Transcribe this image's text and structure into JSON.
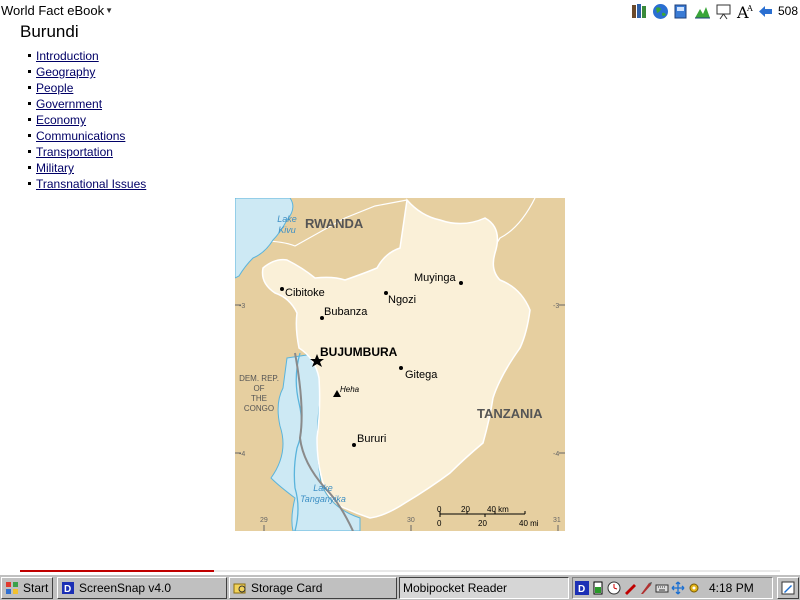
{
  "app": {
    "title": "World Fact eBook",
    "page_number": "508"
  },
  "toolbar": {
    "icons": [
      "library-icon",
      "globe-icon",
      "book-icon",
      "chart-icon",
      "presentation-icon",
      "font-size-icon",
      "back-arrow-icon"
    ]
  },
  "content": {
    "title": "Burundi",
    "nav": [
      {
        "label": "Introduction"
      },
      {
        "label": "Geography"
      },
      {
        "label": "People"
      },
      {
        "label": "Government"
      },
      {
        "label": "Economy"
      },
      {
        "label": "Communications"
      },
      {
        "label": "Transportation"
      },
      {
        "label": "Military"
      },
      {
        "label": "Transnational Issues"
      }
    ]
  },
  "map": {
    "countries": {
      "north": "RWANDA",
      "east": "TANZANIA",
      "west_lines": [
        "DEM. REP.",
        "OF",
        "THE",
        "CONGO"
      ]
    },
    "lakes": {
      "kivu_lines": [
        "Lake",
        "Kivu"
      ],
      "tanganyika_lines": [
        "Lake",
        "Tanganyika"
      ]
    },
    "capital": "BUJUMBURA",
    "cities": [
      "Muyinga",
      "Cibitoke",
      "Ngozi",
      "Bubanza",
      "Gitega",
      "Bururi"
    ],
    "peak": "Heha",
    "grid_labels": {
      "lat": [
        "-3",
        "-4"
      ],
      "lon": [
        "29",
        "30",
        "31"
      ]
    },
    "scale": {
      "km_labels": [
        "0",
        "20",
        "40 km"
      ],
      "mi_labels": [
        "0",
        "20",
        "40 mi"
      ]
    },
    "colors": {
      "country": "#faf0d8",
      "neighbors": "#e6cfa0",
      "water": "#cde9f4",
      "river": "#5ab4dc",
      "border": "#ffffff"
    }
  },
  "reading_progress": 0.255,
  "taskbar": {
    "start_label": "Start",
    "buttons": [
      {
        "label": "ScreenSnap v4.0"
      },
      {
        "label": "Storage Card"
      },
      {
        "label": "Mobipocket Reader"
      }
    ],
    "tray_icons": [
      "mobipocket-d-icon",
      "battery-icon",
      "clock-icon",
      "pen-icon",
      "stylus-icon",
      "keyboard-icon",
      "move-icon",
      "settings-icon"
    ],
    "clock": "4:18 PM"
  }
}
